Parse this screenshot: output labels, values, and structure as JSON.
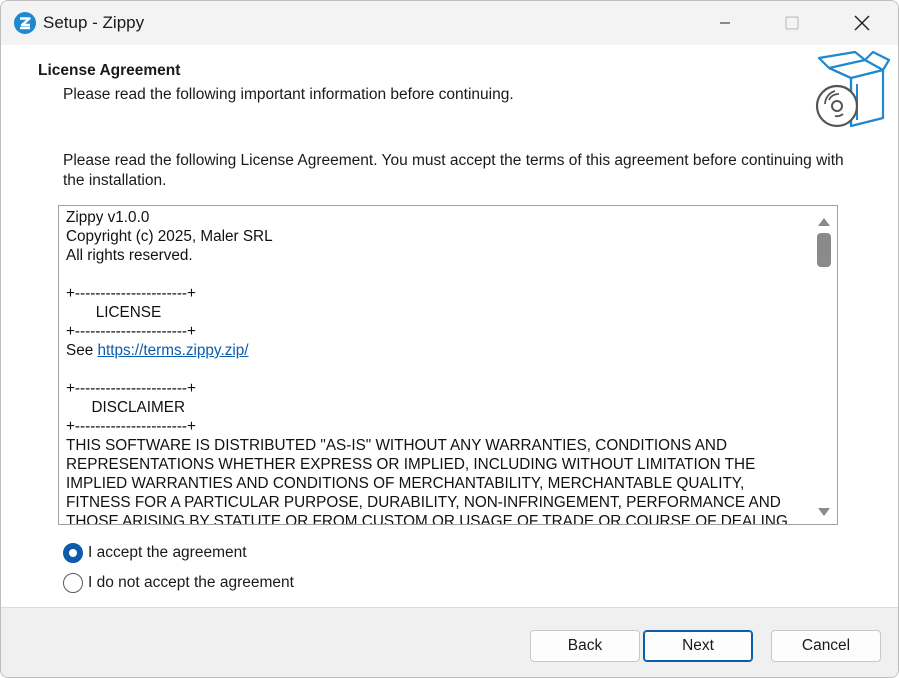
{
  "window": {
    "title": "Setup - Zippy",
    "controls": {
      "minimize_icon": "minimize-icon",
      "maximize_icon": "maximize-icon",
      "close_icon": "close-icon"
    }
  },
  "header": {
    "title": "License Agreement",
    "subtitle": "Please read the following important information before continuing.",
    "image_icon": "box-disc-icon"
  },
  "content": {
    "instruction": "Please read the following License Agreement. You must accept the terms of this agreement before continuing with the installation.",
    "license_lines": [
      "Zippy v1.0.0",
      "Copyright (c) 2025, Maler SRL",
      "All rights reserved.",
      "",
      "+----------------------+",
      "       LICENSE",
      "+----------------------+",
      "See ",
      "",
      "+----------------------+",
      "      DISCLAIMER",
      "+----------------------+",
      "THIS SOFTWARE IS DISTRIBUTED \"AS-IS\" WITHOUT ANY WARRANTIES, CONDITIONS AND",
      "REPRESENTATIONS WHETHER EXPRESS OR IMPLIED, INCLUDING WITHOUT LIMITATION THE",
      "IMPLIED WARRANTIES AND CONDITIONS OF MERCHANTABILITY, MERCHANTABLE QUALITY,",
      "FITNESS FOR A PARTICULAR PURPOSE, DURABILITY, NON-INFRINGEMENT, PERFORMANCE AND",
      "THOSE ARISING BY STATUTE OR FROM CUSTOM OR USAGE OF TRADE OR COURSE OF DEALING"
    ],
    "license_link": "https://terms.zippy.zip/",
    "radio_accept": "I accept the agreement",
    "radio_decline": "I do not accept the agreement",
    "selected": "accept"
  },
  "footer": {
    "back": "Back",
    "next": "Next",
    "cancel": "Cancel"
  },
  "colors": {
    "accent": "#0b5cad",
    "titlebar": "#f3f3f3",
    "footer": "#f0f0f0",
    "icon_blue": "#1e88d0"
  }
}
